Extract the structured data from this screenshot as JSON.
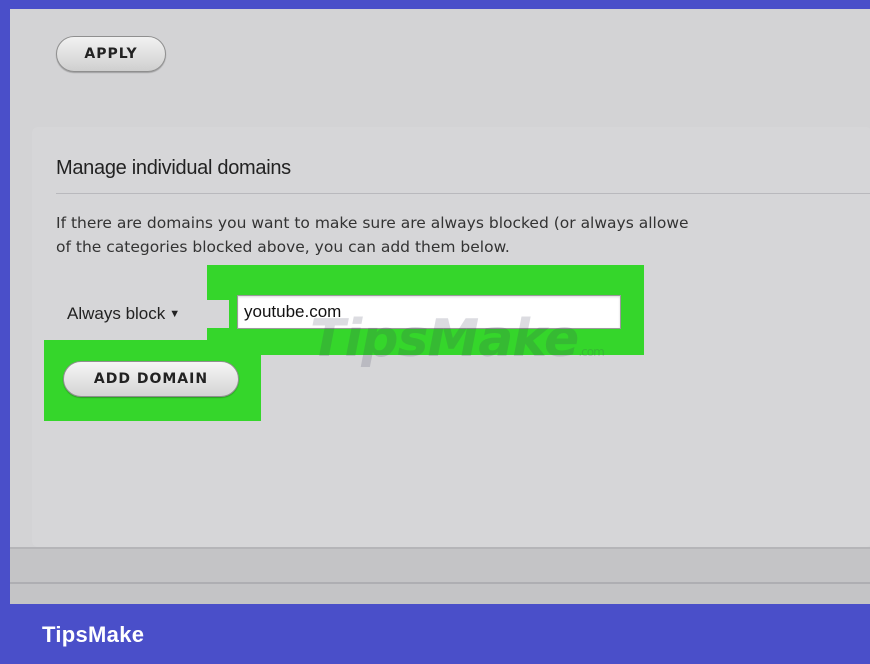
{
  "toolbar": {
    "apply_label": "APPLY"
  },
  "domains": {
    "title": "Manage individual domains",
    "description_line1": "If there are domains you want to make sure are always blocked (or always allowe",
    "description_line2": "of the categories blocked above, you can add them below.",
    "mode_select": {
      "selected": "Always block"
    },
    "domain_input": {
      "value": "youtube.com"
    },
    "add_button_label": "ADD DOMAIN"
  },
  "watermark": {
    "text": "TipsMake",
    "suffix": ".com"
  },
  "brand": {
    "name": "TipsMake"
  },
  "colors": {
    "frame": "#4a4fc9",
    "highlight": "#35d62b",
    "panel": "#d3d3d5"
  }
}
